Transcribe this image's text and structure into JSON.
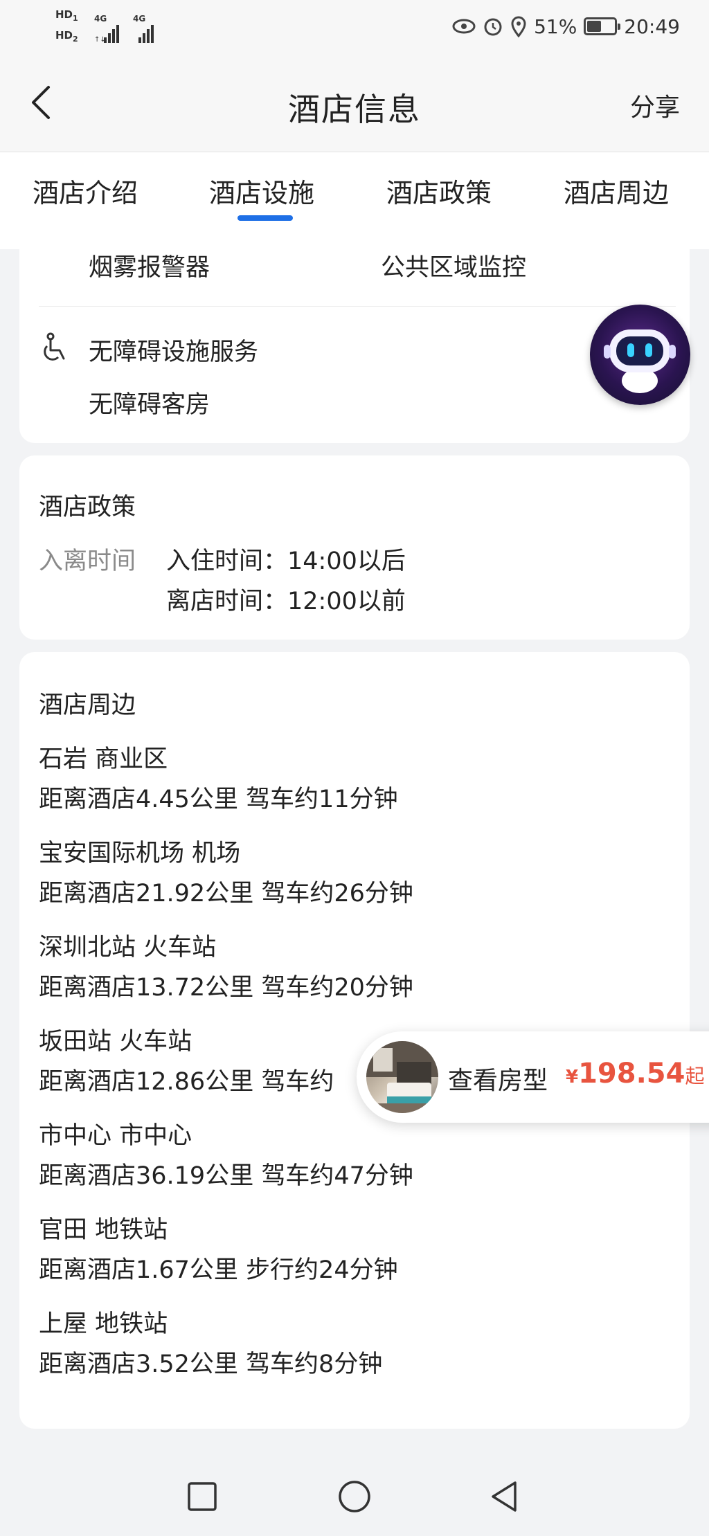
{
  "status_bar": {
    "hd1": "HD",
    "hd1_sub": "1",
    "hd2": "HD",
    "hd2_sub": "2",
    "sig1": "4G",
    "sig2": "4G",
    "battery_text": "51%",
    "battery_level": 0.51,
    "time": "20:49"
  },
  "header": {
    "title": "酒店信息",
    "share": "分享"
  },
  "tabs": [
    "酒店介绍",
    "酒店设施",
    "酒店政策",
    "酒店周边"
  ],
  "active_tab": "酒店设施",
  "facilities": {
    "top_items": [
      "烟雾报警器",
      "公共区域监控"
    ],
    "accessibility": {
      "title": "无障碍设施服务",
      "items": [
        "无障碍客房"
      ]
    }
  },
  "policy": {
    "title": "酒店政策",
    "label": "入离时间",
    "checkin": "入住时间：14:00以后",
    "checkout": "离店时间：12:00以前"
  },
  "nearby": {
    "title": "酒店周边",
    "places": [
      {
        "name": "石岩 商业区",
        "detail": "距离酒店4.45公里  驾车约11分钟"
      },
      {
        "name": "宝安国际机场 机场",
        "detail": "距离酒店21.92公里  驾车约26分钟"
      },
      {
        "name": "深圳北站 火车站",
        "detail": "距离酒店13.72公里  驾车约20分钟"
      },
      {
        "name": "坂田站 火车站",
        "detail": "距离酒店12.86公里  驾车约"
      },
      {
        "name": "市中心 市中心",
        "detail": "距离酒店36.19公里  驾车约47分钟"
      },
      {
        "name": "官田 地铁站",
        "detail": "距离酒店1.67公里  步行约24分钟"
      },
      {
        "name": "上屋 地铁站",
        "detail": "距离酒店3.52公里  驾车约8分钟"
      }
    ]
  },
  "room_pill": {
    "label": "查看房型",
    "currency": "¥",
    "price": "198.54",
    "suffix": "起"
  },
  "colors": {
    "accent": "#1e6fe6",
    "price": "#e8543f"
  },
  "icons": [
    "back-arrow-icon",
    "eye-icon",
    "alarm-icon",
    "location-icon",
    "wheelchair-icon",
    "robot-assistant-icon",
    "nav-recent-icon",
    "nav-home-icon",
    "nav-back-icon"
  ]
}
